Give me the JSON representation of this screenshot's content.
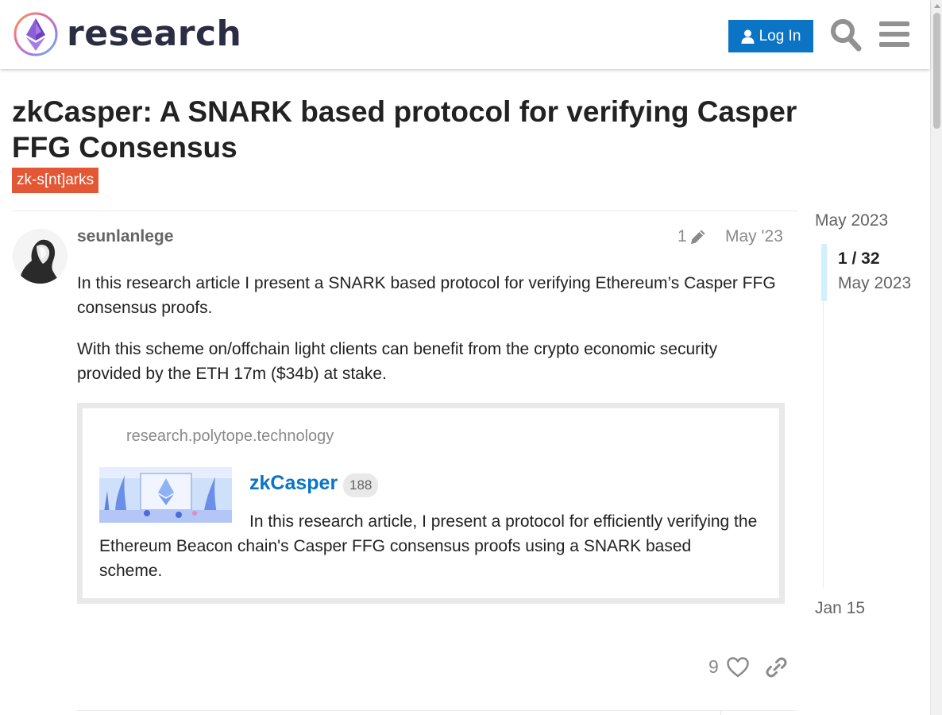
{
  "header": {
    "logo_text": "research",
    "login_label": "Log In"
  },
  "topic": {
    "title": "zkCasper: A SNARK based protocol for verifying Casper FFG Consensus",
    "tag": "zk-s[nt]arks"
  },
  "post": {
    "username": "seunlanlege",
    "edit_count": "1",
    "date": "May '23",
    "paragraph_1": "In this research article I present a SNARK based protocol for verifying Ethereum’s Casper FFG consensus proofs.",
    "paragraph_2": "With this scheme on/offchain light clients can benefit from the crypto economic security provided by the ETH 17m ($34b) at stake.",
    "onebox": {
      "source": "research.polytope.technology",
      "title": "zkCasper",
      "click_count": "188",
      "description": "In this research article, I present a protocol for efficiently verifying the Ethereum Beacon chain's Casper FFG consensus proofs using a SNARK based scheme."
    },
    "like_count": "9"
  },
  "timeline": {
    "start_date": "May 2023",
    "position": "1 / 32",
    "current_date": "May 2023",
    "end_date": "Jan 15"
  },
  "colors": {
    "accent": "#0b74c4",
    "tag": "#e45735",
    "muted": "#8a8a8a",
    "timeline_handle": "#d1f0ff"
  }
}
